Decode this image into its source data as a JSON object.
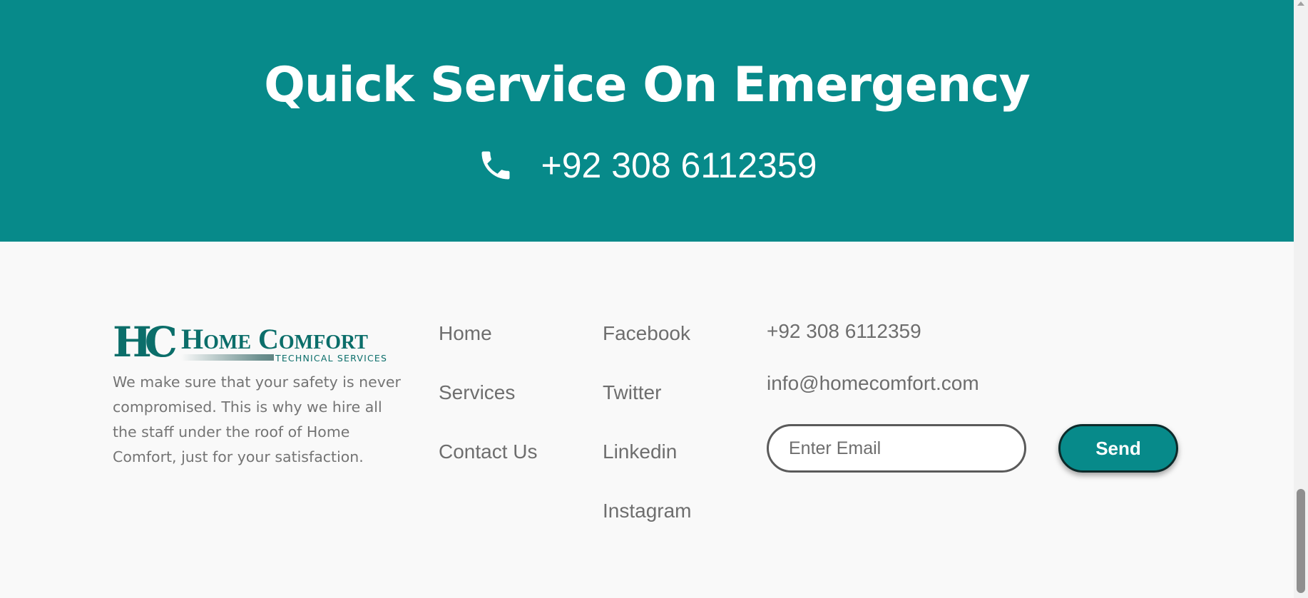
{
  "banner": {
    "title": "Quick Service On Emergency",
    "phone": "+92 308 6112359",
    "icon": "phone-icon",
    "bg_color": "#078a8a"
  },
  "footer": {
    "logo": {
      "mark": "HC",
      "name": "Home Comfort",
      "subtitle": "TECHNICAL SERVICES"
    },
    "about": "We make sure that your safety is never compromised. This is why we hire all the staff under the roof of Home Comfort, just for your satisfaction.",
    "nav_links": [
      "Home",
      "Services",
      "Contact Us"
    ],
    "social_links": [
      "Facebook",
      "Twitter",
      "Linkedin",
      "Instagram"
    ],
    "contact": {
      "phone": "+92 308 6112359",
      "email": "info@homecomfort.com"
    },
    "newsletter": {
      "placeholder": "Enter Email",
      "value": "",
      "button_label": "Send"
    }
  }
}
